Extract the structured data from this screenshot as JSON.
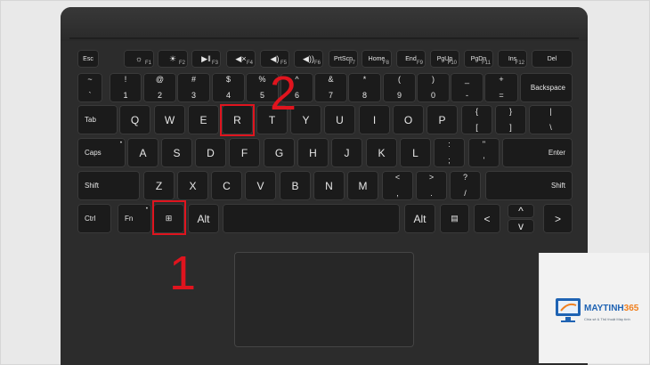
{
  "rows": {
    "function": [
      {
        "main": "Esc"
      },
      {
        "icon": "brightness-down-icon",
        "fn": "F1"
      },
      {
        "icon": "brightness-up-icon",
        "fn": "F2"
      },
      {
        "icon": "play-pause-icon",
        "fn": "F3"
      },
      {
        "icon": "mute-icon",
        "fn": "F4"
      },
      {
        "icon": "volume-down-icon",
        "fn": "F5"
      },
      {
        "icon": "volume-up-icon",
        "fn": "F6"
      },
      {
        "main": "PrtScn",
        "fn": "F7"
      },
      {
        "main": "Home",
        "fn": "F8"
      },
      {
        "main": "End",
        "fn": "F9"
      },
      {
        "main": "PgUp",
        "fn": "F10"
      },
      {
        "main": "PgDn",
        "fn": "F11"
      },
      {
        "main": "Ins",
        "fn": "F12"
      },
      {
        "main": "Del"
      }
    ],
    "number": [
      {
        "top": "~",
        "bottom": "`"
      },
      {
        "top": "!",
        "bottom": "1"
      },
      {
        "top": "@",
        "bottom": "2"
      },
      {
        "top": "#",
        "bottom": "3"
      },
      {
        "top": "$",
        "bottom": "4"
      },
      {
        "top": "%",
        "bottom": "5"
      },
      {
        "top": "^",
        "bottom": "6"
      },
      {
        "top": "&",
        "bottom": "7"
      },
      {
        "top": "*",
        "bottom": "8"
      },
      {
        "top": "(",
        "bottom": "9"
      },
      {
        "top": ")",
        "bottom": "0"
      },
      {
        "top": "_",
        "bottom": "-"
      },
      {
        "top": "+",
        "bottom": "="
      },
      {
        "main": "Backspace"
      }
    ],
    "top": [
      {
        "main": "Tab"
      },
      {
        "main": "Q"
      },
      {
        "main": "W"
      },
      {
        "main": "E"
      },
      {
        "main": "R"
      },
      {
        "main": "T"
      },
      {
        "main": "Y"
      },
      {
        "main": "U"
      },
      {
        "main": "I"
      },
      {
        "main": "O"
      },
      {
        "main": "P"
      },
      {
        "top": "{",
        "bottom": "["
      },
      {
        "top": "}",
        "bottom": "]"
      },
      {
        "top": "|",
        "bottom": "\\"
      }
    ],
    "home": [
      {
        "main": "Caps"
      },
      {
        "main": "A"
      },
      {
        "main": "S"
      },
      {
        "main": "D"
      },
      {
        "main": "F"
      },
      {
        "main": "G"
      },
      {
        "main": "H"
      },
      {
        "main": "J"
      },
      {
        "main": "K"
      },
      {
        "main": "L"
      },
      {
        "top": ":",
        "bottom": ";"
      },
      {
        "top": "\"",
        "bottom": "'"
      },
      {
        "main": "Enter"
      }
    ],
    "shift": [
      {
        "main": "Shift"
      },
      {
        "main": "Z"
      },
      {
        "main": "X"
      },
      {
        "main": "C"
      },
      {
        "main": "V"
      },
      {
        "main": "B"
      },
      {
        "main": "N"
      },
      {
        "main": "M"
      },
      {
        "top": "<",
        "bottom": ","
      },
      {
        "top": ">",
        "bottom": "."
      },
      {
        "top": "?",
        "bottom": "/"
      },
      {
        "main": "Shift"
      }
    ],
    "bottom": [
      {
        "main": "Ctrl"
      },
      {
        "main": "Fn"
      },
      {
        "icon": "windows-logo-icon"
      },
      {
        "main": "Alt"
      },
      {
        "main": ""
      },
      {
        "main": "Alt"
      },
      {
        "icon": "menu-key-icon"
      },
      {
        "main": "<"
      },
      {
        "main": "^"
      },
      {
        "main": "v"
      },
      {
        "main": ">"
      }
    ]
  },
  "annotations": {
    "step1": "1",
    "step2": "2"
  },
  "watermark": {
    "brand_main": "MAYTINH",
    "brand_accent": "365",
    "tagline": "Chia sẻ & Thủ thuật Máy tính"
  },
  "colors": {
    "highlight": "#e0141e",
    "keyboard": "#2c2c2c",
    "key": "#1b1b1b",
    "brand_blue": "#1f63b3",
    "brand_orange": "#f08020"
  }
}
